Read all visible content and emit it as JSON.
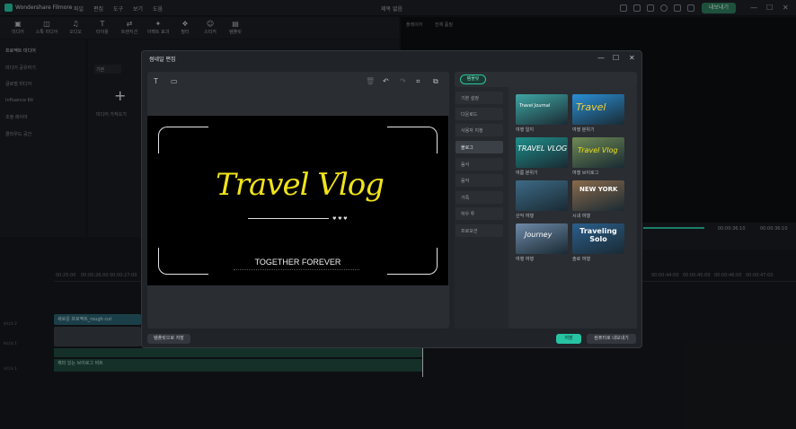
{
  "app": {
    "title": "Wondershare Filmore",
    "menu": [
      "파일",
      "편집",
      "도구",
      "보기",
      "도움"
    ],
    "project_title": "제목 없음",
    "export_label": "내보내기"
  },
  "toolbar": {
    "items": [
      {
        "label": "미디어",
        "icon": "media-icon"
      },
      {
        "label": "스톡 미디어",
        "icon": "stock-media-icon"
      },
      {
        "label": "오디오",
        "icon": "audio-icon"
      },
      {
        "label": "타이틀",
        "icon": "title-icon"
      },
      {
        "label": "트랜지션",
        "icon": "transition-icon"
      },
      {
        "label": "이펙트 효과",
        "icon": "effects-icon"
      },
      {
        "label": "필터",
        "icon": "filter-icon"
      },
      {
        "label": "스티커",
        "icon": "sticker-icon"
      },
      {
        "label": "템플릿",
        "icon": "template-icon"
      }
    ]
  },
  "left_panel": {
    "items": [
      {
        "label": "프로젝트 미디어",
        "active": true
      },
      {
        "label": "미디어 공유하기",
        "active": false
      },
      {
        "label": "글로벌 미디어",
        "active": false
      },
      {
        "label": "Influence Kit",
        "active": false
      },
      {
        "label": "조정 레이어",
        "active": false
      },
      {
        "label": "클라우드 공간",
        "active": false
      }
    ]
  },
  "media_panel": {
    "import_label": "미디어 가져오기",
    "sort_label": "기본"
  },
  "right_panel": {
    "tabs": [
      "플레이어",
      "전체 품질"
    ]
  },
  "player": {
    "time_current": "00:00:36:10",
    "time_total": "00:00:36:10"
  },
  "timeline": {
    "ruler": [
      "00:25:00",
      "00:00:26:00",
      "00:00:27:00",
      "00:00:44:00",
      "00:00:45:00",
      "00:00:46:00",
      "00:00:47:00"
    ],
    "clips": {
      "title_clip": "새로운 프로젝트_rough cut",
      "audio_clip": "재미 있는 브이로그 비트"
    },
    "track_labels": [
      "비디오 2",
      "비디오 1",
      "오디오 1"
    ]
  },
  "dialog": {
    "title": "썸네일 편집",
    "canvas_title": "Travel Vlog",
    "canvas_subtitle": "TOGETHER FOREVER",
    "template_tab": "템플릿",
    "categories": [
      {
        "label": "기본 설정",
        "active": false
      },
      {
        "label": "다운로드",
        "active": false
      },
      {
        "label": "사용자 지정",
        "active": false
      },
      {
        "label": "블로그",
        "active": true
      },
      {
        "label": "음식",
        "active": false
      },
      {
        "label": "음악",
        "active": false
      },
      {
        "label": "가족",
        "active": false
      },
      {
        "label": "하우 투",
        "active": false
      },
      {
        "label": "프로모션",
        "active": false
      }
    ],
    "templates": [
      {
        "label": "여행 일지",
        "text": "Travel Journal",
        "color": "#3fa7a4"
      },
      {
        "label": "여행 분위기",
        "text": "Travel",
        "color": "#2a8fd6"
      },
      {
        "label": "여름 분위기",
        "text": "TRAVEL VLOG",
        "color": "#1e8f8a"
      },
      {
        "label": "여행 브이로그",
        "text": "Travel Vlog",
        "color": "#6f8a55"
      },
      {
        "label": "산악 여행",
        "text": "",
        "color": "#3d6a86"
      },
      {
        "label": "시내 여행",
        "text": "NEW YORK",
        "color": "#8a6a4c"
      },
      {
        "label": "여행 여행",
        "text": "Journey",
        "color": "#6e8aa8"
      },
      {
        "label": "솔로 여행",
        "text": "Traveling Solo",
        "color": "#2b5f8c"
      }
    ],
    "save_template_label": "템플릿으로 저장",
    "save_label": "저장",
    "export_label": "컴퓨터로 내보내기"
  }
}
